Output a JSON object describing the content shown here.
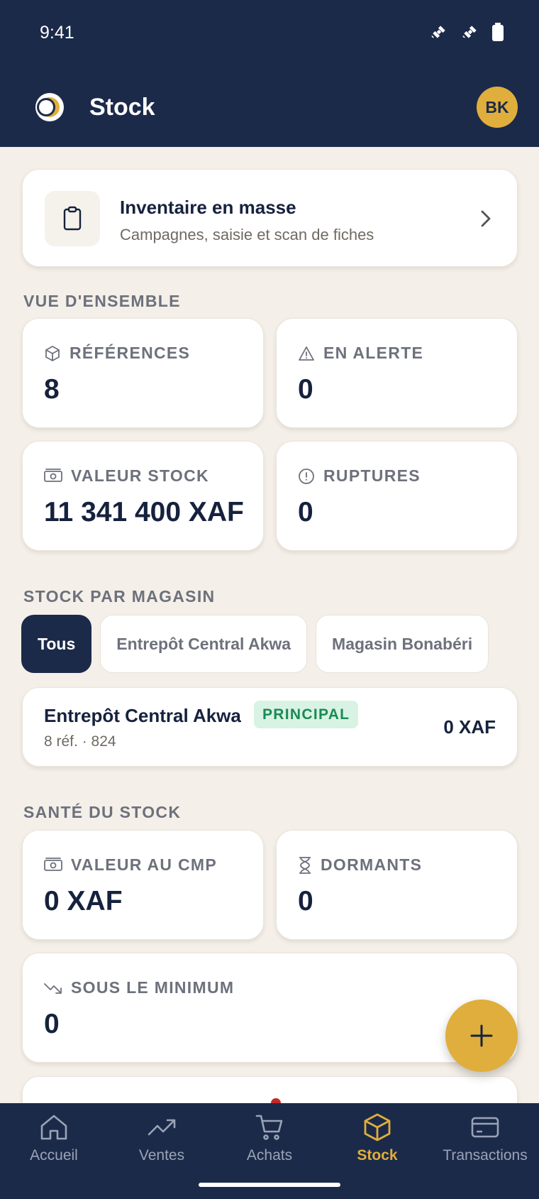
{
  "status_bar": {
    "time": "9:41"
  },
  "header": {
    "title": "Stock",
    "avatar_initials": "BK"
  },
  "colors": {
    "navy": "#1c2a4a",
    "gold": "#e0ae3c",
    "background": "#f4efe8",
    "success": "#1a8a55"
  },
  "inventory_card": {
    "title": "Inventaire en masse",
    "subtitle": "Campagnes, saisie et scan de fiches",
    "icon": "clipboard-icon"
  },
  "overview": {
    "label": "VUE D'ENSEMBLE",
    "stats": [
      {
        "label": "RÉFÉRENCES",
        "value": "8",
        "icon": "box-icon"
      },
      {
        "label": "EN ALERTE",
        "value": "0",
        "icon": "warning-icon"
      },
      {
        "label": "VALEUR STOCK",
        "value": "11 341 400 XAF",
        "icon": "banknote-icon"
      },
      {
        "label": "RUPTURES",
        "value": "0",
        "icon": "alert-circle-icon"
      }
    ]
  },
  "stores": {
    "label": "STOCK PAR MAGASIN",
    "chips": [
      {
        "label": "Tous",
        "active": true
      },
      {
        "label": "Entrepôt Central Akwa",
        "active": false
      },
      {
        "label": "Magasin Bonabéri",
        "active": false
      }
    ],
    "list": [
      {
        "name": "Entrepôt Central Akwa",
        "badge": "PRINCIPAL",
        "meta": "8 réf. · 824",
        "value": "0 XAF"
      }
    ]
  },
  "health": {
    "label": "SANTÉ DU STOCK",
    "stats": [
      {
        "label": "VALEUR AU CMP",
        "value": "0 XAF",
        "icon": "banknote-icon"
      },
      {
        "label": "DORMANTS",
        "value": "0",
        "icon": "hourglass-icon"
      },
      {
        "label": "SOUS LE MINIMUM",
        "value": "0",
        "icon": "trending-down-icon"
      }
    ]
  },
  "fab": {
    "icon": "plus-icon"
  },
  "bottom_nav": [
    {
      "label": "Accueil",
      "icon": "home-icon",
      "active": false
    },
    {
      "label": "Ventes",
      "icon": "trending-up-icon",
      "active": false
    },
    {
      "label": "Achats",
      "icon": "cart-icon",
      "active": false
    },
    {
      "label": "Stock",
      "icon": "box-icon",
      "active": true
    },
    {
      "label": "Transactions",
      "icon": "credit-card-icon",
      "active": false
    }
  ]
}
